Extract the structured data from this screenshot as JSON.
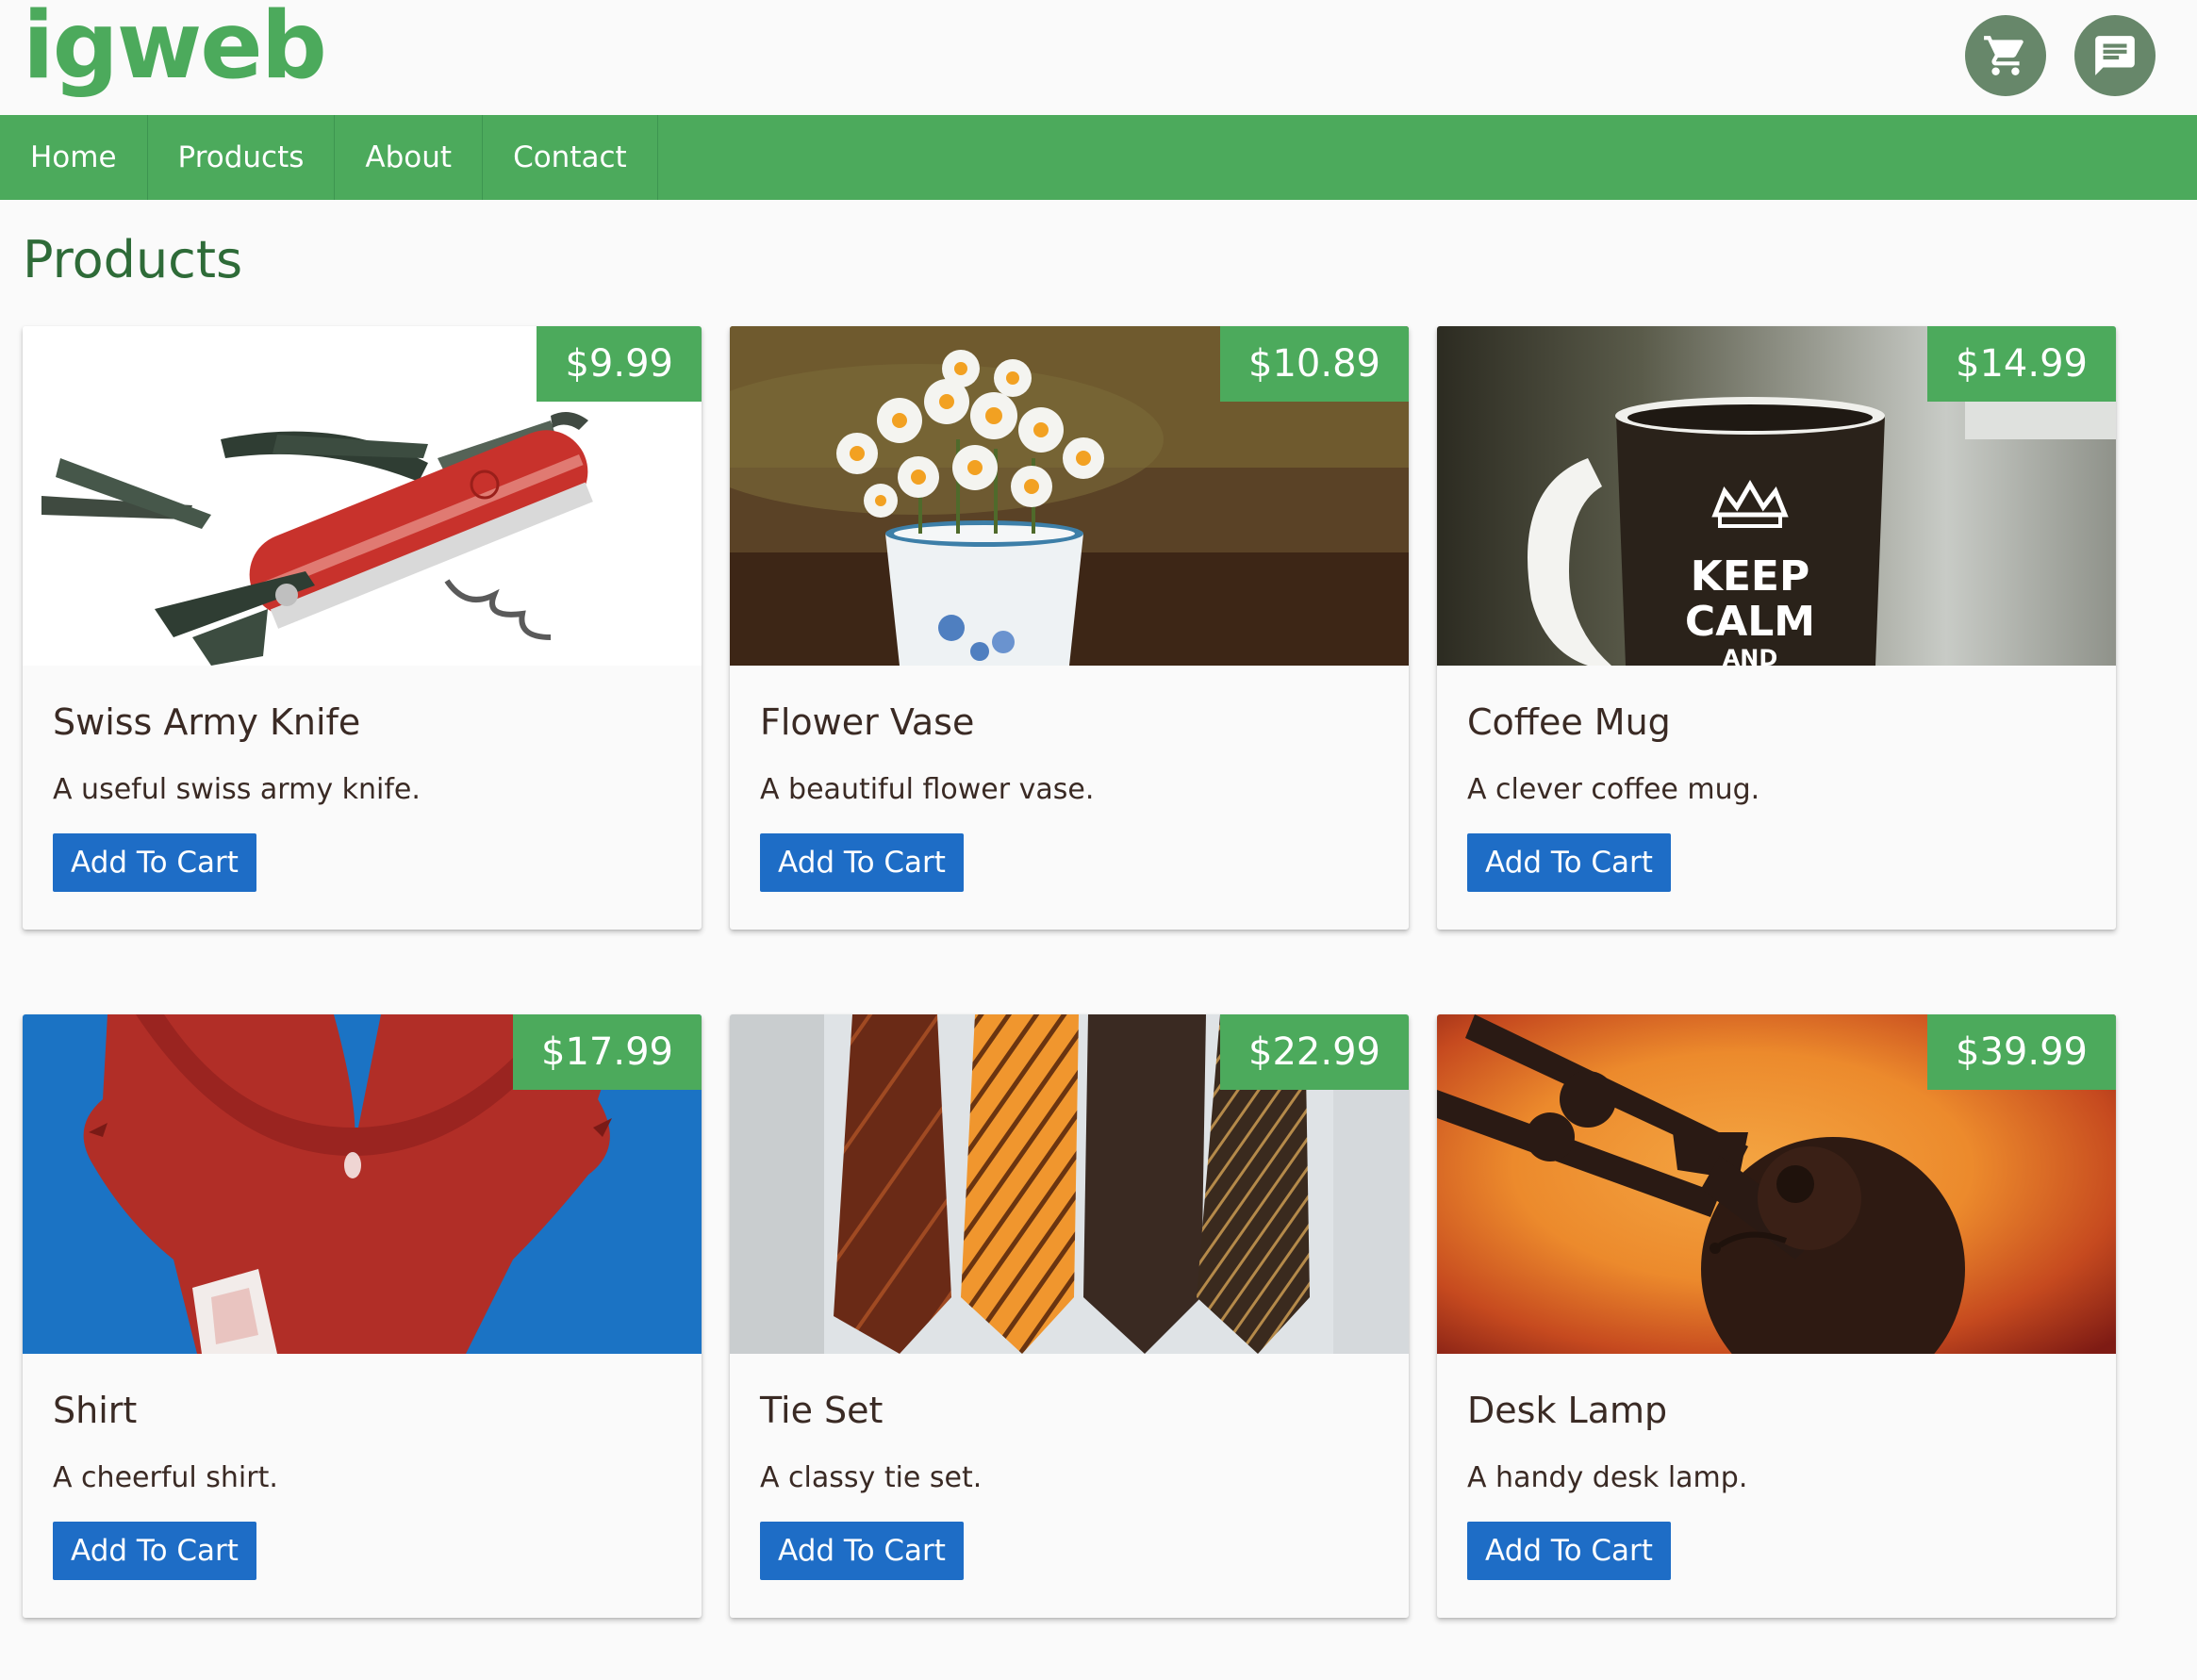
{
  "app": {
    "logo": "igweb"
  },
  "header": {
    "cart_icon": "shopping-cart-icon",
    "chat_icon": "chat-icon"
  },
  "nav": {
    "items": [
      {
        "label": "Home"
      },
      {
        "label": "Products"
      },
      {
        "label": "About"
      },
      {
        "label": "Contact"
      }
    ]
  },
  "page": {
    "title": "Products"
  },
  "products": [
    {
      "name": "Swiss Army Knife",
      "description": "A useful swiss army knife.",
      "price": "$9.99",
      "button": "Add To Cart"
    },
    {
      "name": "Flower Vase",
      "description": "A beautiful flower vase.",
      "price": "$10.89",
      "button": "Add To Cart"
    },
    {
      "name": "Coffee Mug",
      "description": "A clever coffee mug.",
      "price": "$14.99",
      "button": "Add To Cart",
      "image_text": [
        "KEEP",
        "CALM",
        "AND"
      ]
    },
    {
      "name": "Shirt",
      "description": "A cheerful shirt.",
      "price": "$17.99",
      "button": "Add To Cart"
    },
    {
      "name": "Tie Set",
      "description": "A classy tie set.",
      "price": "$22.99",
      "button": "Add To Cart"
    },
    {
      "name": "Desk Lamp",
      "description": "A handy desk lamp.",
      "price": "$39.99",
      "button": "Add To Cart"
    }
  ],
  "colors": {
    "brand_green": "#4caa5c",
    "button_blue": "#1e6dc6",
    "title_green": "#2e6b38"
  }
}
